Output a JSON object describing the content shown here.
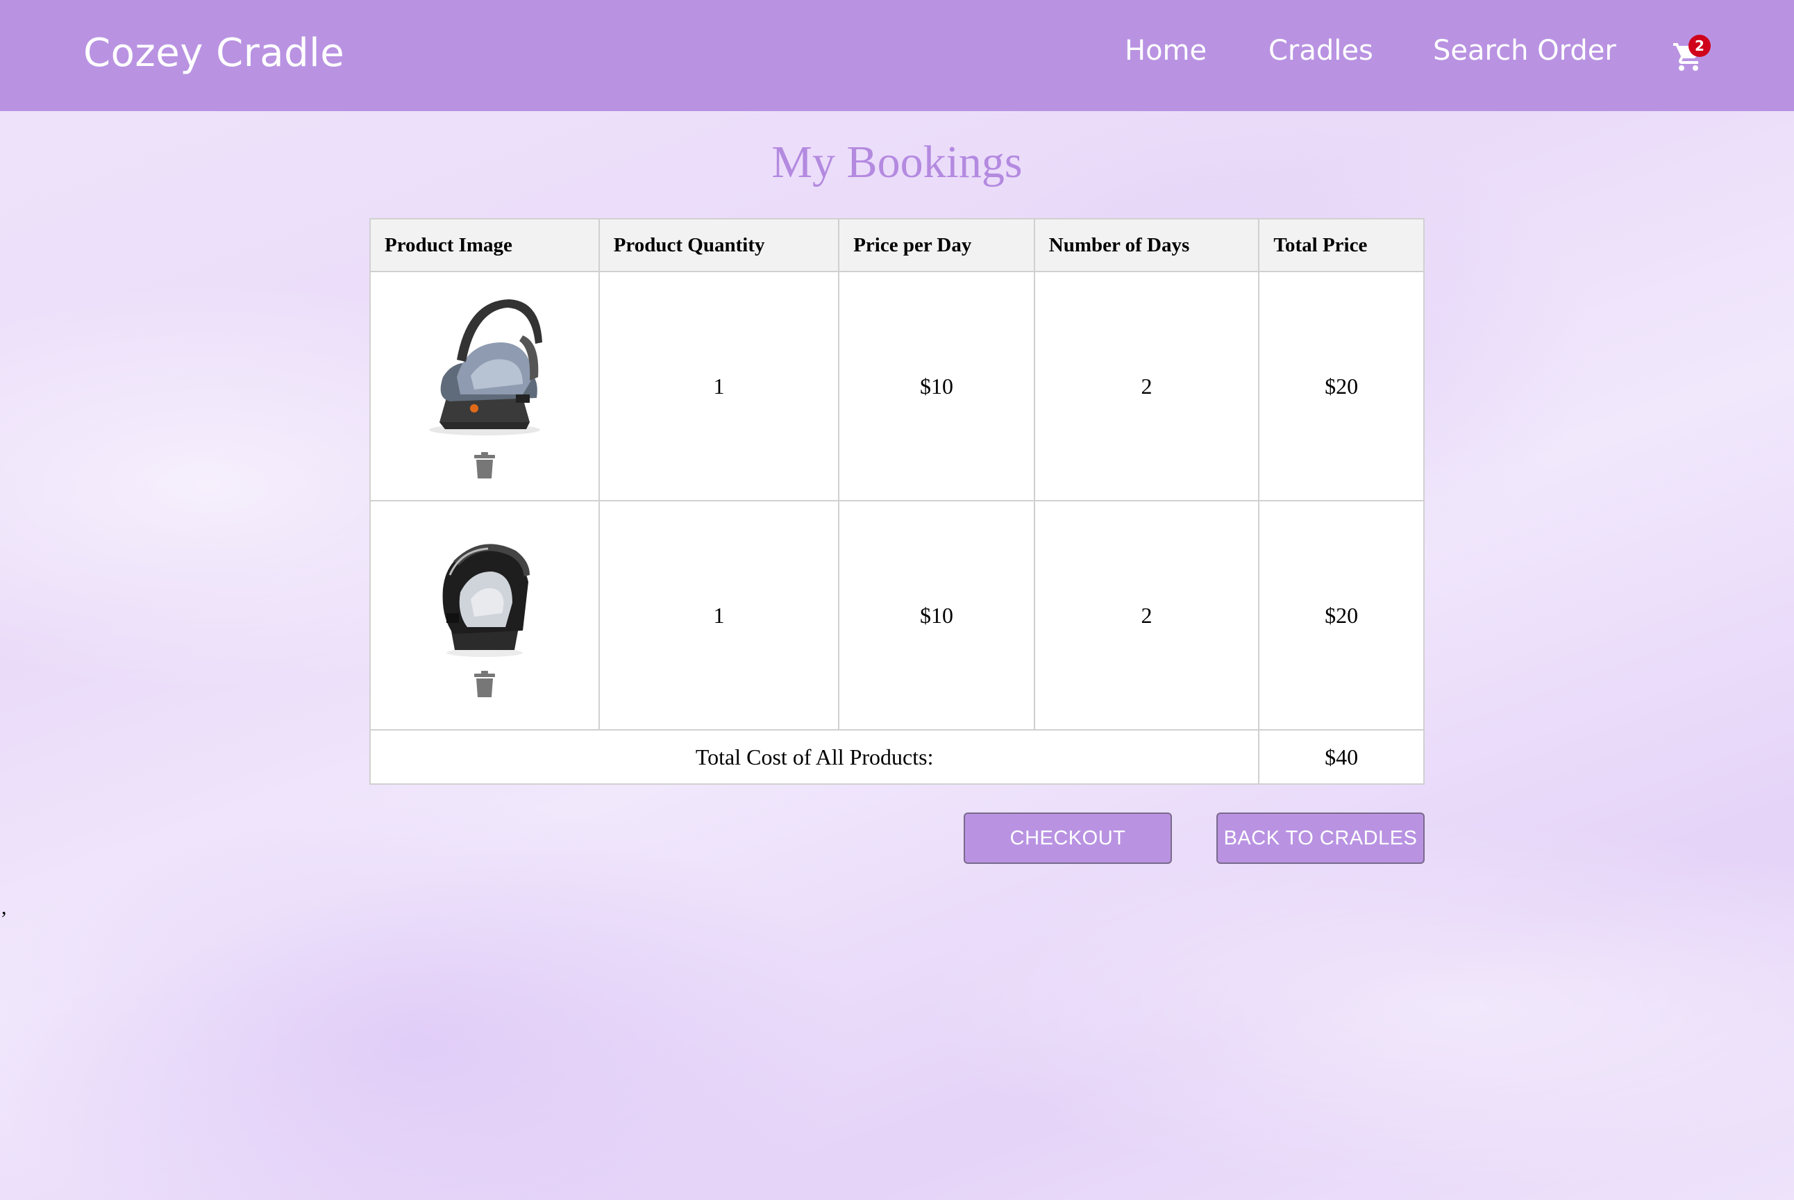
{
  "header": {
    "brand": "Cozey Cradle",
    "nav": [
      "Home",
      "Cradles",
      "Search Order"
    ],
    "cart_count": "2",
    "colors": {
      "bar": "#b993e2",
      "badge": "#d0021b"
    }
  },
  "page": {
    "title": "My Bookings",
    "title_color": "#b48ae0"
  },
  "table": {
    "headers": [
      "Product Image",
      "Product Quantity",
      "Price per Day",
      "Number of Days",
      "Total Price"
    ],
    "rows": [
      {
        "image": "infant-car-seat-gray-icon",
        "quantity": "1",
        "price_per_day": "$10",
        "days": "2",
        "total": "$20"
      },
      {
        "image": "infant-car-seat-black-icon",
        "quantity": "1",
        "price_per_day": "$10",
        "days": "2",
        "total": "$20"
      }
    ],
    "total_label": "Total Cost of All Products:",
    "total_value": "$40"
  },
  "actions": {
    "checkout": "CHECKOUT",
    "back": "BACK TO CRADLES"
  },
  "stray_text": ","
}
